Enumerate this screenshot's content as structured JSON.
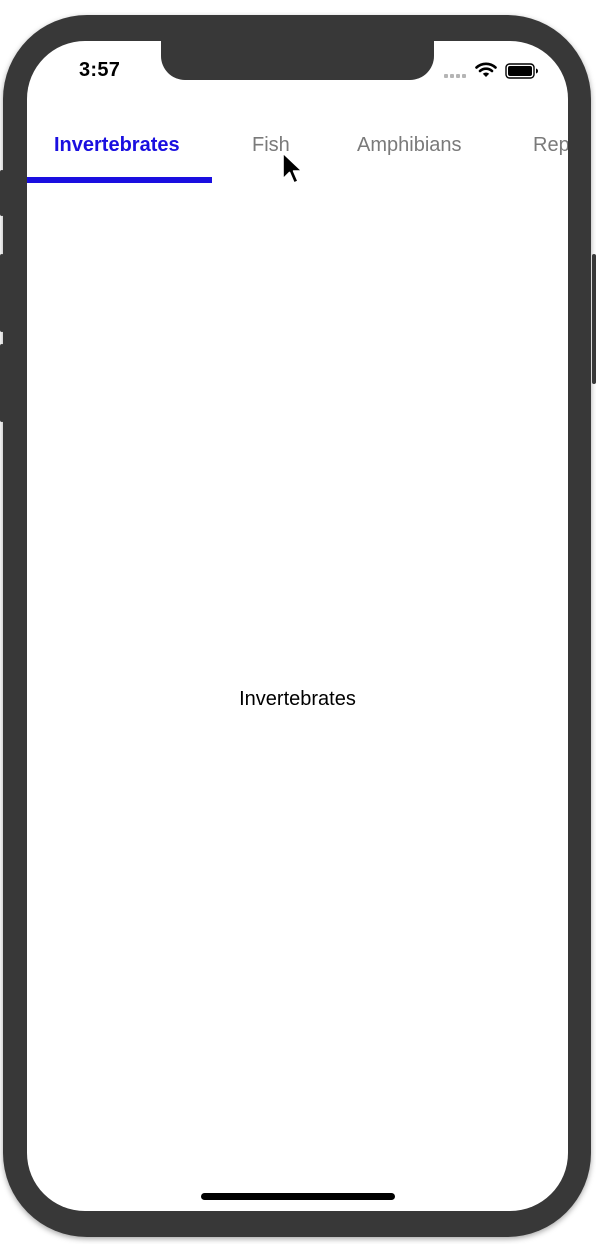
{
  "status_bar": {
    "time": "3:57",
    "signal_icon": "cellular-signal-icon",
    "wifi_icon": "wifi-icon",
    "battery_icon": "battery-icon"
  },
  "tabs": [
    {
      "label": "Invertebrates",
      "active": true
    },
    {
      "label": "Fish",
      "active": false
    },
    {
      "label": "Amphibians",
      "active": false
    },
    {
      "label": "Reptiles",
      "active": false
    }
  ],
  "content": {
    "label": "Invertebrates"
  },
  "colors": {
    "accent": "#1a0fe0",
    "inactive_tab": "#7a7a7a",
    "device_frame": "#383838"
  },
  "cursor_icon": "mouse-pointer-icon"
}
